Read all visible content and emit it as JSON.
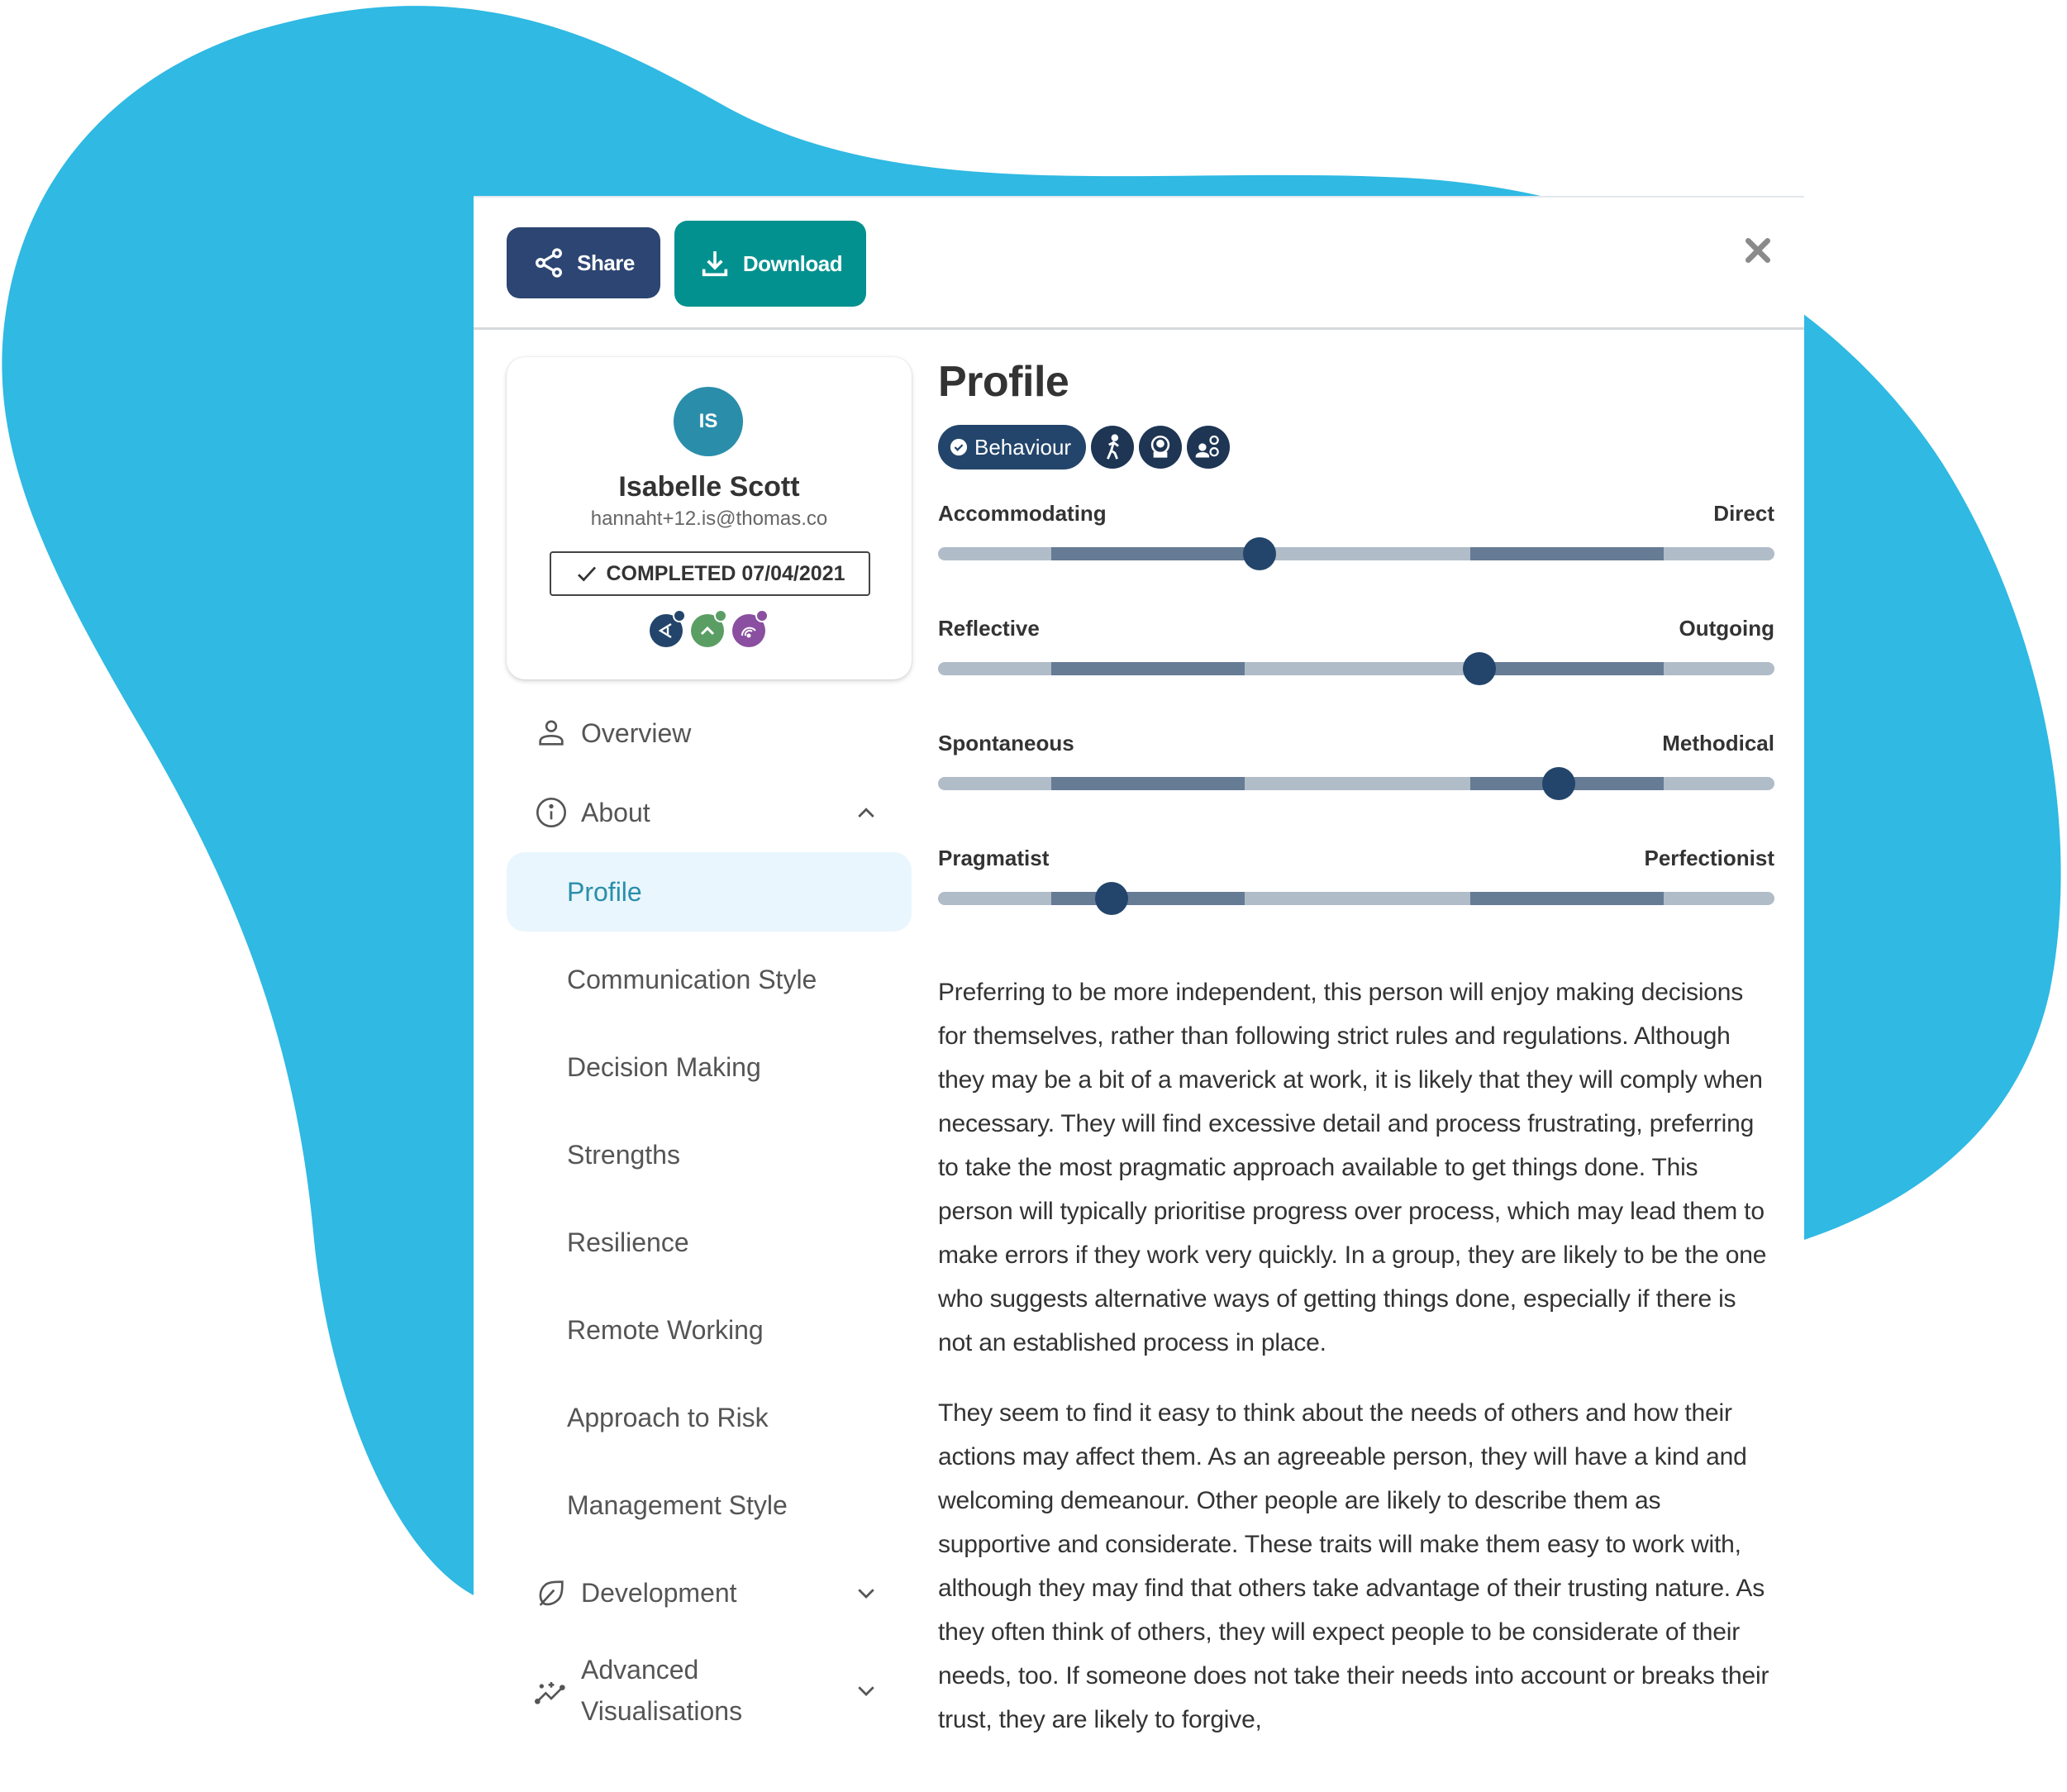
{
  "colors": {
    "blob": "#2fb9e3",
    "share_button": "#2c4572",
    "download_button": "#03918f",
    "avatar": "#2a8eab",
    "active_nav_bg": "#e9f6fd",
    "active_nav_text": "#2a8eab",
    "slider_thumb": "#23456b",
    "track_light": "#b0bcc8",
    "track_dark": "#667b94"
  },
  "header": {
    "share_label": "Share",
    "share_icon": "share-icon",
    "download_label": "Download",
    "download_icon": "download-icon",
    "close_icon": "close-icon"
  },
  "card": {
    "initials": "IS",
    "name": "Isabelle Scott",
    "email": "hannaht+12.is@thomas.co",
    "status": "COMPLETED 07/04/2021",
    "status_icon": "check-icon",
    "assessment_icons": [
      {
        "name": "behaviour-assessment-icon",
        "color": "#23456b"
      },
      {
        "name": "aptitude-assessment-icon",
        "color": "#5a9e64"
      },
      {
        "name": "personality-assessment-icon",
        "color": "#8a4fa0"
      }
    ]
  },
  "sidebar": {
    "items": [
      {
        "label": "Overview",
        "icon": "user-icon",
        "level": 0
      },
      {
        "label": "About",
        "icon": "info-icon",
        "level": 0,
        "expanded": true
      },
      {
        "label": "Profile",
        "level": 1,
        "active": true
      },
      {
        "label": "Communication Style",
        "level": 1
      },
      {
        "label": "Decision Making",
        "level": 1
      },
      {
        "label": "Strengths",
        "level": 1
      },
      {
        "label": "Resilience",
        "level": 1
      },
      {
        "label": "Remote Working",
        "level": 1
      },
      {
        "label": "Approach to Risk",
        "level": 1
      },
      {
        "label": "Management Style",
        "level": 1
      },
      {
        "label": "Development",
        "icon": "leaf-icon",
        "level": 0,
        "expanded": false
      },
      {
        "label": "Advanced Visualisations",
        "icon": "chart-sparkle-icon",
        "level": 0,
        "expanded": false
      }
    ]
  },
  "main": {
    "title": "Profile",
    "behaviour_tag": "Behaviour",
    "tag_icons": [
      "running-person-icon",
      "person-badge-icon",
      "people-network-icon"
    ],
    "scales": [
      {
        "left": "Accommodating",
        "right": "Direct",
        "value": 0.384
      },
      {
        "left": "Reflective",
        "right": "Outgoing",
        "value": 0.647
      },
      {
        "left": "Spontaneous",
        "right": "Methodical",
        "value": 0.742
      },
      {
        "left": "Pragmatist",
        "right": "Perfectionist",
        "value": 0.208
      }
    ],
    "scale_bands": [
      [
        0.135,
        0.367
      ],
      [
        0.636,
        0.868
      ]
    ],
    "paragraphs": [
      "Preferring to be more independent, this person will enjoy making decisions for themselves, rather than following strict rules and regulations. Although they may be a bit of a maverick at work, it is likely that they will comply when necessary. They will find excessive detail and process frustrating, preferring to take the most pragmatic approach available to get things done. This person will typically prioritise progress over process, which may lead them to make errors if they work very quickly. In a group, they are likely to be the one who suggests alternative ways of getting things done, especially if there is not an established process in place.",
      "They seem to find it easy to think about the needs of others and how their actions may affect them. As an agreeable person, they will have a kind and welcoming demeanour. Other people are likely to describe them as supportive and considerate. These traits will make them easy to work with, although they may find that others take advantage of their trusting nature. As they often think of others, they will expect people to be considerate of their needs, too. If someone does not take their needs into account or breaks their trust, they are likely to forgive,"
    ]
  }
}
